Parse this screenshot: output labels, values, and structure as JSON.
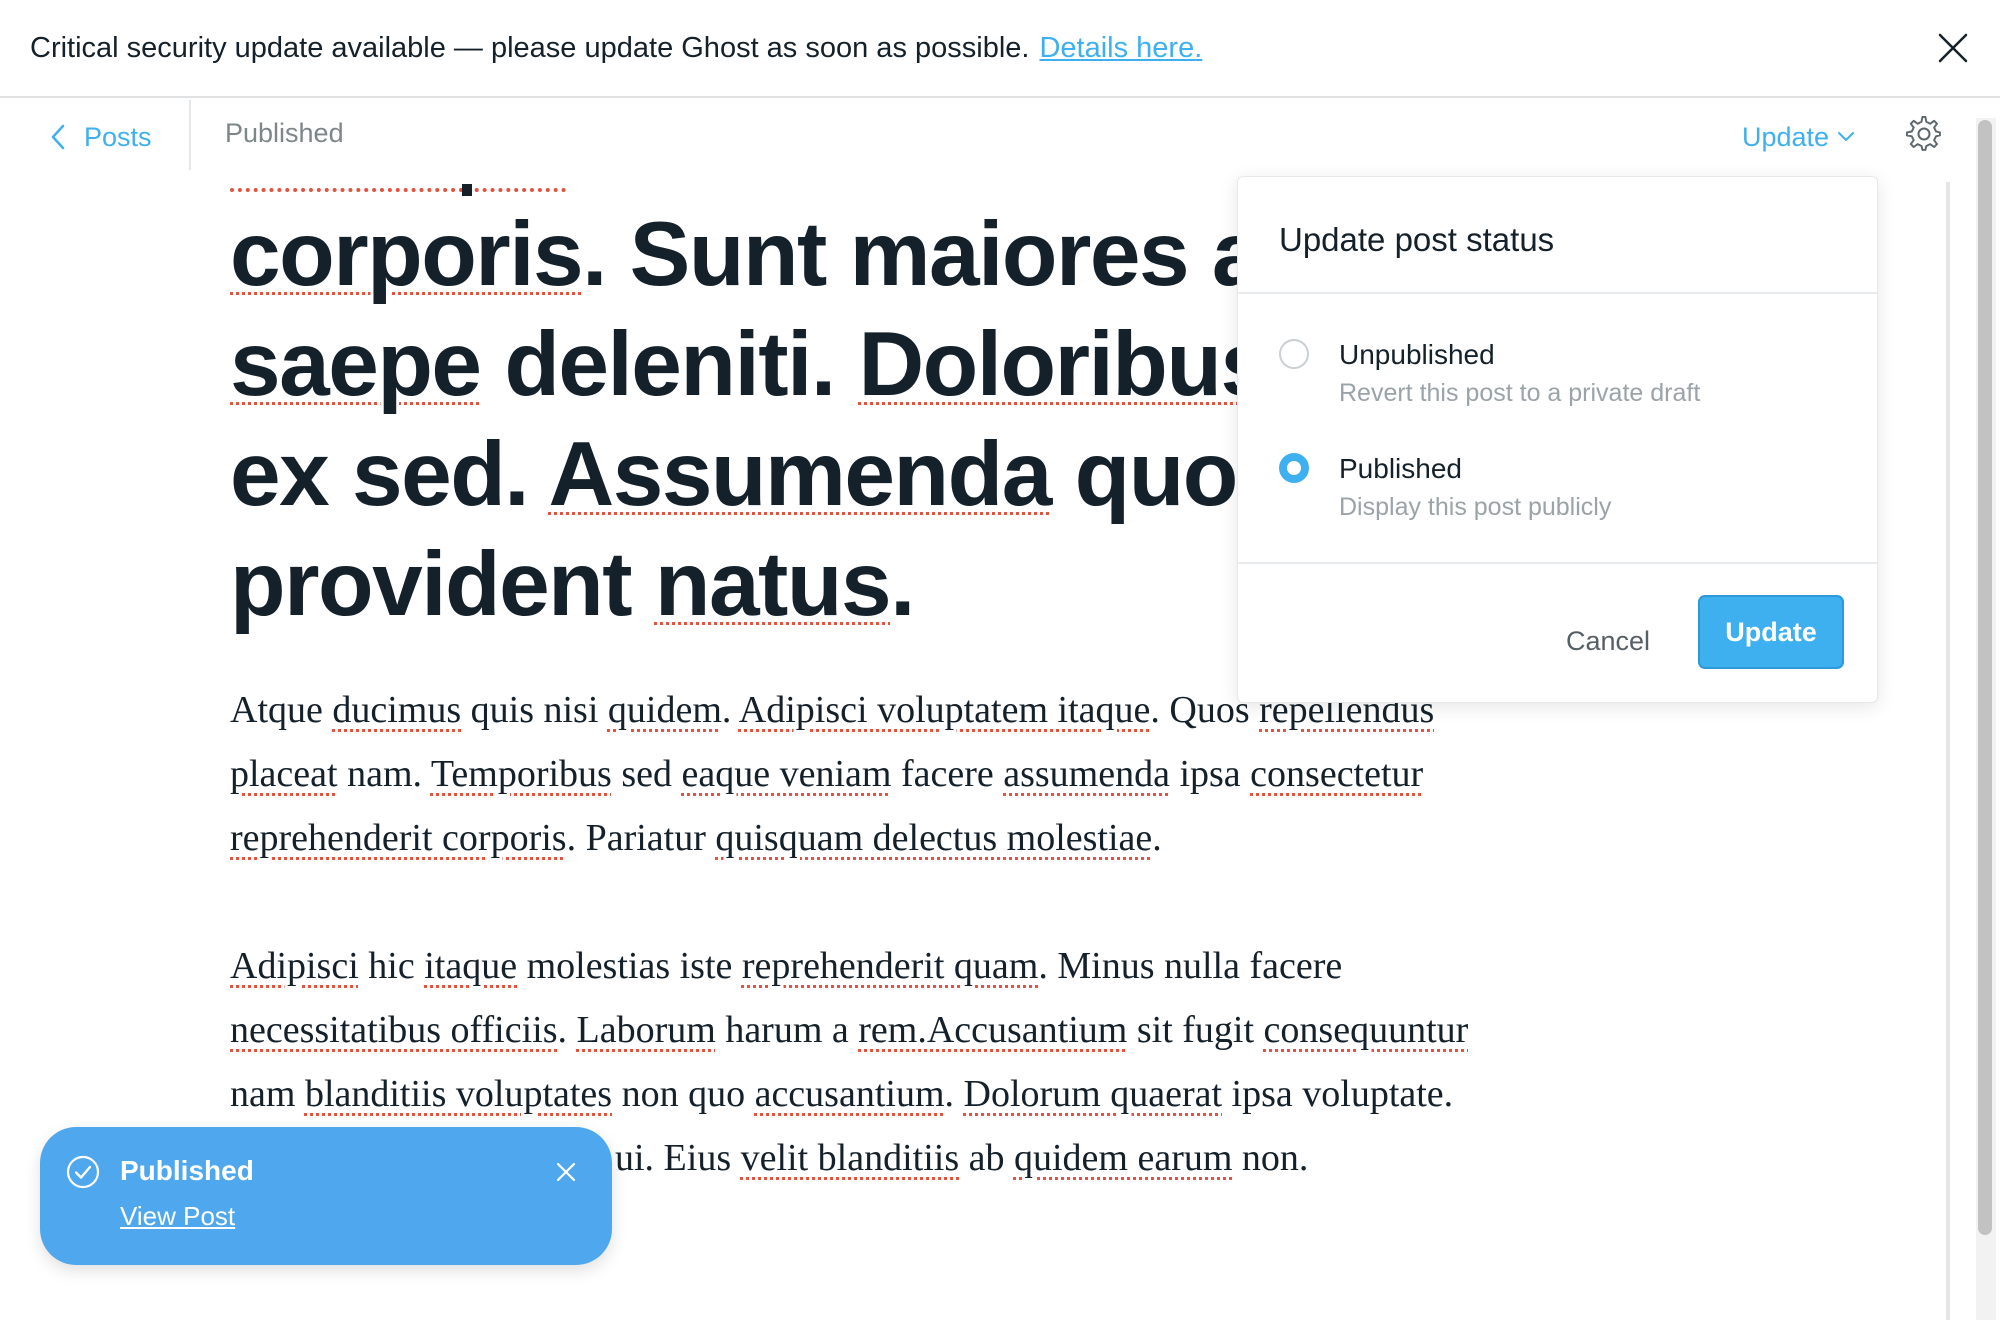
{
  "banner": {
    "message": "Critical security update available — please update Ghost as soon as possible.",
    "link_text": "Details here.",
    "close_icon": "close-icon"
  },
  "header": {
    "back_label": "Posts",
    "status": "Published",
    "update_label": "Update",
    "settings_icon": "gear-icon"
  },
  "post": {
    "title_lines": [
      "corporis. Sunt maiores a",
      "saepe deleniti. Doloribus",
      "ex sed. Assumenda quo",
      "provident natus."
    ],
    "paragraphs": [
      {
        "lines": [
          "Atque ducimus quis nisi quidem. Adipisci voluptatem itaque. Quos repellendus",
          "placeat nam. Temporibus sed eaque veniam facere assumenda ipsa consectetur",
          "reprehenderit corporis. Pariatur quisquam delectus molestiae."
        ]
      },
      {
        "lines": [
          "Adipisci hic itaque molestias iste reprehenderit quam. Minus nulla facere",
          "necessitatibus officiis. Laborum harum a rem.Accusantium sit fugit consequuntur",
          "nam blanditiis voluptates non quo accusantium. Dolorum quaerat ipsa voluptate.",
          "ui. Eius velit blanditiis ab quidem earum non."
        ]
      }
    ]
  },
  "popover": {
    "title": "Update post status",
    "options": [
      {
        "label": "Unpublished",
        "description": "Revert this post to a private draft",
        "selected": false
      },
      {
        "label": "Published",
        "description": "Display this post publicly",
        "selected": true
      }
    ],
    "cancel_label": "Cancel",
    "update_label": "Update"
  },
  "toast": {
    "title": "Published",
    "link_text": "View Post",
    "check_icon": "check-circle-icon",
    "close_icon": "close-icon"
  },
  "colors": {
    "accent": "#3eb0ef",
    "toast_bg": "#4fa8ee",
    "text": "#15212a",
    "spellcheck": "#e25440"
  }
}
